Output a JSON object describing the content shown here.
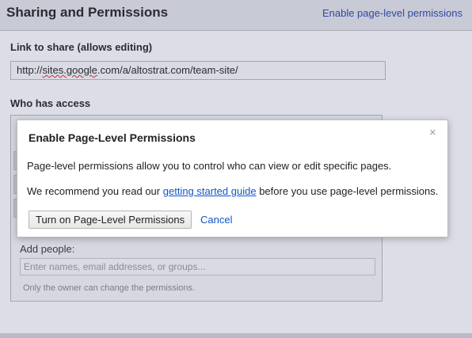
{
  "panel": {
    "title": "Sharing and Permissions",
    "enable_link": "Enable page-level permissions",
    "link_label": "Link to share (allows editing)",
    "link_value_prefix": "http://",
    "link_value_misspelled": "sites.google",
    "link_value_rest": ".com/a/altostrat.com/team-site/",
    "access_label": "Who has access",
    "add_people_label": "Add people:",
    "add_people_placeholder": "Enter names, email addresses, or groups...",
    "owner_note": "Only the owner can change the permissions."
  },
  "modal": {
    "title": "Enable Page-Level Permissions",
    "close_glyph": "×",
    "line1": "Page-level permissions allow you to control who can view or edit specific pages.",
    "line2_before": "We recommend you read our",
    "line2_link": "getting started guide",
    "line2_after": "before you use page-level permissions.",
    "turn_on_button": "Turn on Page-Level Permissions",
    "cancel_link": "Cancel"
  }
}
